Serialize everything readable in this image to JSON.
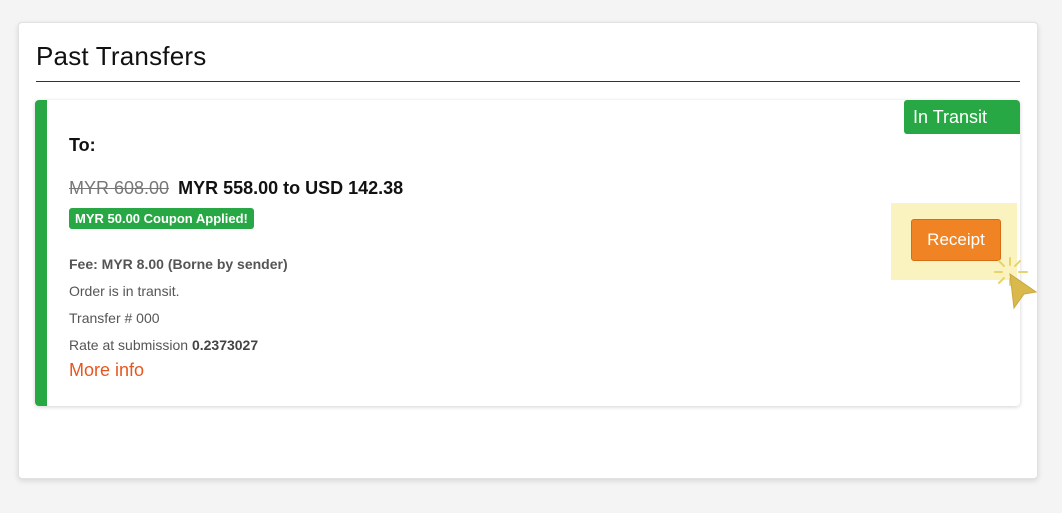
{
  "section": {
    "title": "Past Transfers"
  },
  "transfer": {
    "status": "In Transit",
    "to_label": "To:",
    "original_amount": "MYR 608.00",
    "final_amount": "MYR 558.00 to USD 142.38",
    "coupon_text": "MYR 50.00 Coupon Applied!",
    "fee_text": "Fee: MYR 8.00 (Borne by sender)",
    "status_message": "Order is in transit.",
    "transfer_number": "Transfer # 000",
    "rate_label": "Rate at submission",
    "rate_value": "0.2373027",
    "more_info_label": "More info",
    "receipt_label": "Receipt"
  },
  "colors": {
    "success_green": "#28a745",
    "receipt_orange": "#f08424",
    "link_orange": "#e8561f",
    "highlight_yellow": "#fbf3bf"
  },
  "icons": {
    "cursor": "click-cursor-icon"
  }
}
